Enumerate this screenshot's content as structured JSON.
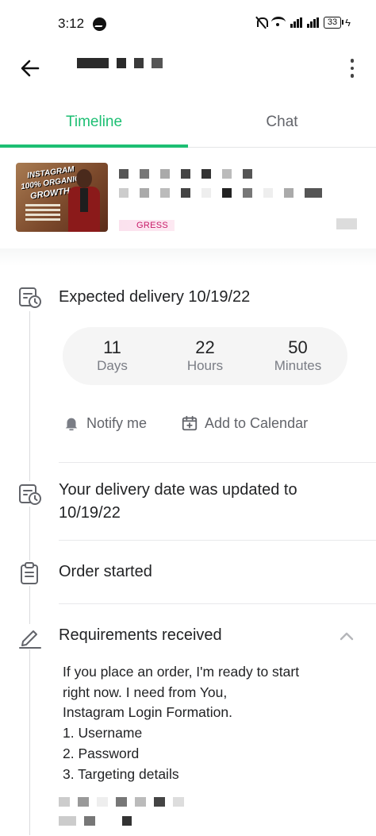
{
  "status_bar": {
    "time": "3:12",
    "battery": "33",
    "charging_symbol": "ϟ"
  },
  "header": {
    "back_icon": "arrow-left-icon",
    "more_icon": "more-vertical-icon"
  },
  "tabs": [
    {
      "label": "Timeline",
      "active": true
    },
    {
      "label": "Chat",
      "active": false
    }
  ],
  "gig": {
    "thumbnail_lines": [
      "INSTAGRAM",
      "100% ORGANIC",
      "GROWTH"
    ],
    "status": "GRESS"
  },
  "countdown": [
    {
      "value": "11",
      "unit": "Days"
    },
    {
      "value": "22",
      "unit": "Hours"
    },
    {
      "value": "50",
      "unit": "Minutes"
    }
  ],
  "timeline": {
    "expected_delivery": "Expected delivery 10/19/22",
    "notify_label": "Notify me",
    "calendar_label": "Add to Calendar",
    "delivery_updated_line1": "Your delivery date was updated to",
    "delivery_updated_line2": "10/19/22",
    "order_started": "Order started",
    "requirements_received": "Requirements received",
    "requirements_lines": [
      "If you place an order, I'm ready to start",
      "right now. I need from You,",
      "Instagram Login Formation.",
      "1. Username",
      "2. Password",
      "3. Targeting details"
    ]
  },
  "colors": {
    "accent": "#1dbf73",
    "text": "#222325",
    "muted": "#62646a",
    "status_pink": "#c71a68"
  }
}
